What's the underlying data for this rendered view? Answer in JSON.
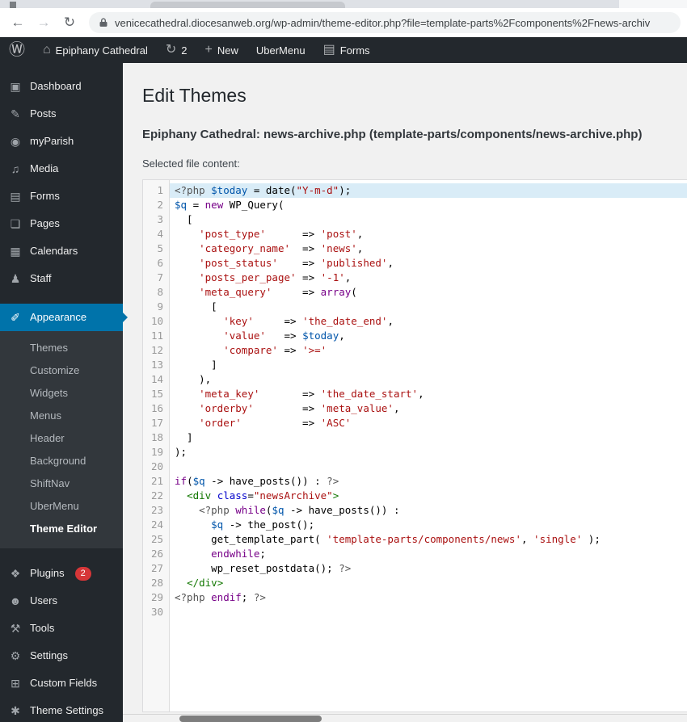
{
  "browser": {
    "url": "venicecathedral.diocesanweb.org/wp-admin/theme-editor.php?file=template-parts%2Fcomponents%2Fnews-archiv",
    "back_icon": "←",
    "forward_icon": "→",
    "refresh_icon": "↻"
  },
  "admin_bar": {
    "items": [
      {
        "id": "wp-logo",
        "glyph": "Ⓦ",
        "label": "",
        "logo": true
      },
      {
        "id": "site-name",
        "glyph": "⌂",
        "label": "Epiphany Cathedral"
      },
      {
        "id": "updates",
        "glyph": "↻",
        "label": "2"
      },
      {
        "id": "new-content",
        "glyph": "+",
        "label": "New"
      },
      {
        "id": "ubermenu",
        "glyph": "",
        "label": "UberMenu"
      },
      {
        "id": "forms",
        "glyph": "▤",
        "label": "Forms"
      }
    ]
  },
  "sidebar": {
    "items": [
      {
        "id": "dashboard",
        "glyph": "▣",
        "label": "Dashboard"
      },
      {
        "id": "posts",
        "glyph": "✎",
        "label": "Posts"
      },
      {
        "id": "myparish",
        "glyph": "◉",
        "label": "myParish"
      },
      {
        "id": "media",
        "glyph": "♫",
        "label": "Media"
      },
      {
        "id": "forms",
        "glyph": "▤",
        "label": "Forms"
      },
      {
        "id": "pages",
        "glyph": "❏",
        "label": "Pages"
      },
      {
        "id": "calendars",
        "glyph": "▦",
        "label": "Calendars"
      },
      {
        "id": "staff",
        "glyph": "♟",
        "label": "Staff"
      },
      {
        "id": "appearance",
        "glyph": "✐",
        "label": "Appearance",
        "current": true,
        "separator_before": true,
        "submenu": [
          "Themes",
          "Customize",
          "Widgets",
          "Menus",
          "Header",
          "Background",
          "ShiftNav",
          "UberMenu",
          "Theme Editor"
        ],
        "submenu_current": "Theme Editor"
      },
      {
        "id": "plugins",
        "glyph": "❖",
        "label": "Plugins",
        "badge": "2",
        "separator_before": true
      },
      {
        "id": "users",
        "glyph": "☻",
        "label": "Users"
      },
      {
        "id": "tools",
        "glyph": "⚒",
        "label": "Tools"
      },
      {
        "id": "settings",
        "glyph": "⚙",
        "label": "Settings"
      },
      {
        "id": "custom-fields",
        "glyph": "⊞",
        "label": "Custom Fields"
      },
      {
        "id": "theme-settings",
        "glyph": "✱",
        "label": "Theme Settings"
      }
    ]
  },
  "main": {
    "page_title": "Edit Themes",
    "file_heading": "Epiphany Cathedral: news-archive.php (template-parts/components/news-archive.php)",
    "selected_label": "Selected file content:"
  },
  "editor": {
    "active_line": 1,
    "lines": [
      [
        [
          "m",
          "<?php "
        ],
        [
          "v",
          "$today"
        ],
        [
          "p",
          " = date("
        ],
        [
          "s",
          "\"Y-m-d\""
        ],
        [
          "p",
          ");"
        ]
      ],
      [
        [
          "v",
          "$q"
        ],
        [
          "p",
          " = "
        ],
        [
          "k",
          "new"
        ],
        [
          "p",
          " WP_Query("
        ]
      ],
      [
        [
          "p",
          "  ["
        ]
      ],
      [
        [
          "p",
          "    "
        ],
        [
          "s",
          "'post_type'"
        ],
        [
          "p",
          "      => "
        ],
        [
          "s",
          "'post'"
        ],
        [
          "p",
          ","
        ]
      ],
      [
        [
          "p",
          "    "
        ],
        [
          "s",
          "'category_name'"
        ],
        [
          "p",
          "  => "
        ],
        [
          "s",
          "'news'"
        ],
        [
          "p",
          ","
        ]
      ],
      [
        [
          "p",
          "    "
        ],
        [
          "s",
          "'post_status'"
        ],
        [
          "p",
          "    => "
        ],
        [
          "s",
          "'published'"
        ],
        [
          "p",
          ","
        ]
      ],
      [
        [
          "p",
          "    "
        ],
        [
          "s",
          "'posts_per_page'"
        ],
        [
          "p",
          " => "
        ],
        [
          "s",
          "'-1'"
        ],
        [
          "p",
          ","
        ]
      ],
      [
        [
          "p",
          "    "
        ],
        [
          "s",
          "'meta_query'"
        ],
        [
          "p",
          "     => "
        ],
        [
          "k",
          "array"
        ],
        [
          "p",
          "("
        ]
      ],
      [
        [
          "p",
          "      ["
        ]
      ],
      [
        [
          "p",
          "        "
        ],
        [
          "s",
          "'key'"
        ],
        [
          "p",
          "     => "
        ],
        [
          "s",
          "'the_date_end'"
        ],
        [
          "p",
          ","
        ]
      ],
      [
        [
          "p",
          "        "
        ],
        [
          "s",
          "'value'"
        ],
        [
          "p",
          "   => "
        ],
        [
          "v",
          "$today"
        ],
        [
          "p",
          ","
        ]
      ],
      [
        [
          "p",
          "        "
        ],
        [
          "s",
          "'compare'"
        ],
        [
          "p",
          " => "
        ],
        [
          "s",
          "'>='"
        ]
      ],
      [
        [
          "p",
          "      ]"
        ]
      ],
      [
        [
          "p",
          "    ),"
        ]
      ],
      [
        [
          "p",
          "    "
        ],
        [
          "s",
          "'meta_key'"
        ],
        [
          "p",
          "       => "
        ],
        [
          "s",
          "'the_date_start'"
        ],
        [
          "p",
          ","
        ]
      ],
      [
        [
          "p",
          "    "
        ],
        [
          "s",
          "'orderby'"
        ],
        [
          "p",
          "        => "
        ],
        [
          "s",
          "'meta_value'"
        ],
        [
          "p",
          ","
        ]
      ],
      [
        [
          "p",
          "    "
        ],
        [
          "s",
          "'order'"
        ],
        [
          "p",
          "          => "
        ],
        [
          "s",
          "'ASC'"
        ]
      ],
      [
        [
          "p",
          "  ]"
        ]
      ],
      [
        [
          "p",
          ");"
        ]
      ],
      [],
      [
        [
          "k",
          "if"
        ],
        [
          "p",
          "("
        ],
        [
          "v",
          "$q"
        ],
        [
          "p",
          " -> have_posts()) : "
        ],
        [
          "m",
          "?>"
        ]
      ],
      [
        [
          "p",
          "  "
        ],
        [
          "t",
          "<div"
        ],
        [
          "p",
          " "
        ],
        [
          "a",
          "class"
        ],
        [
          "p",
          "="
        ],
        [
          "s",
          "\"newsArchive\""
        ],
        [
          "t",
          ">"
        ]
      ],
      [
        [
          "p",
          "    "
        ],
        [
          "m",
          "<?php "
        ],
        [
          "k",
          "while"
        ],
        [
          "p",
          "("
        ],
        [
          "v",
          "$q"
        ],
        [
          "p",
          " -> have_posts()) :"
        ]
      ],
      [
        [
          "p",
          "      "
        ],
        [
          "v",
          "$q"
        ],
        [
          "p",
          " -> the_post();"
        ]
      ],
      [
        [
          "p",
          "      get_template_part( "
        ],
        [
          "s",
          "'template-parts/components/news'"
        ],
        [
          "p",
          ", "
        ],
        [
          "s",
          "'single'"
        ],
        [
          "p",
          " );"
        ]
      ],
      [
        [
          "p",
          "      "
        ],
        [
          "k",
          "endwhile"
        ],
        [
          "p",
          ";"
        ]
      ],
      [
        [
          "p",
          "      wp_reset_postdata(); "
        ],
        [
          "m",
          "?>"
        ]
      ],
      [
        [
          "p",
          "  "
        ],
        [
          "t",
          "</div>"
        ]
      ],
      [
        [
          "m",
          "<?php "
        ],
        [
          "k",
          "endif"
        ],
        [
          "p",
          "; "
        ],
        [
          "m",
          "?>"
        ]
      ],
      []
    ]
  },
  "colors": {
    "accent_blue": "#0073aa",
    "badge_red": "#d63638",
    "admin_dark": "#23282d",
    "submenu_dark": "#32373c",
    "active_line_bg": "#d9ecf7",
    "token_keyword": "#770088",
    "token_string": "#aa1111",
    "token_variable": "#0055aa",
    "token_meta": "#555555",
    "token_tag": "#117700"
  }
}
